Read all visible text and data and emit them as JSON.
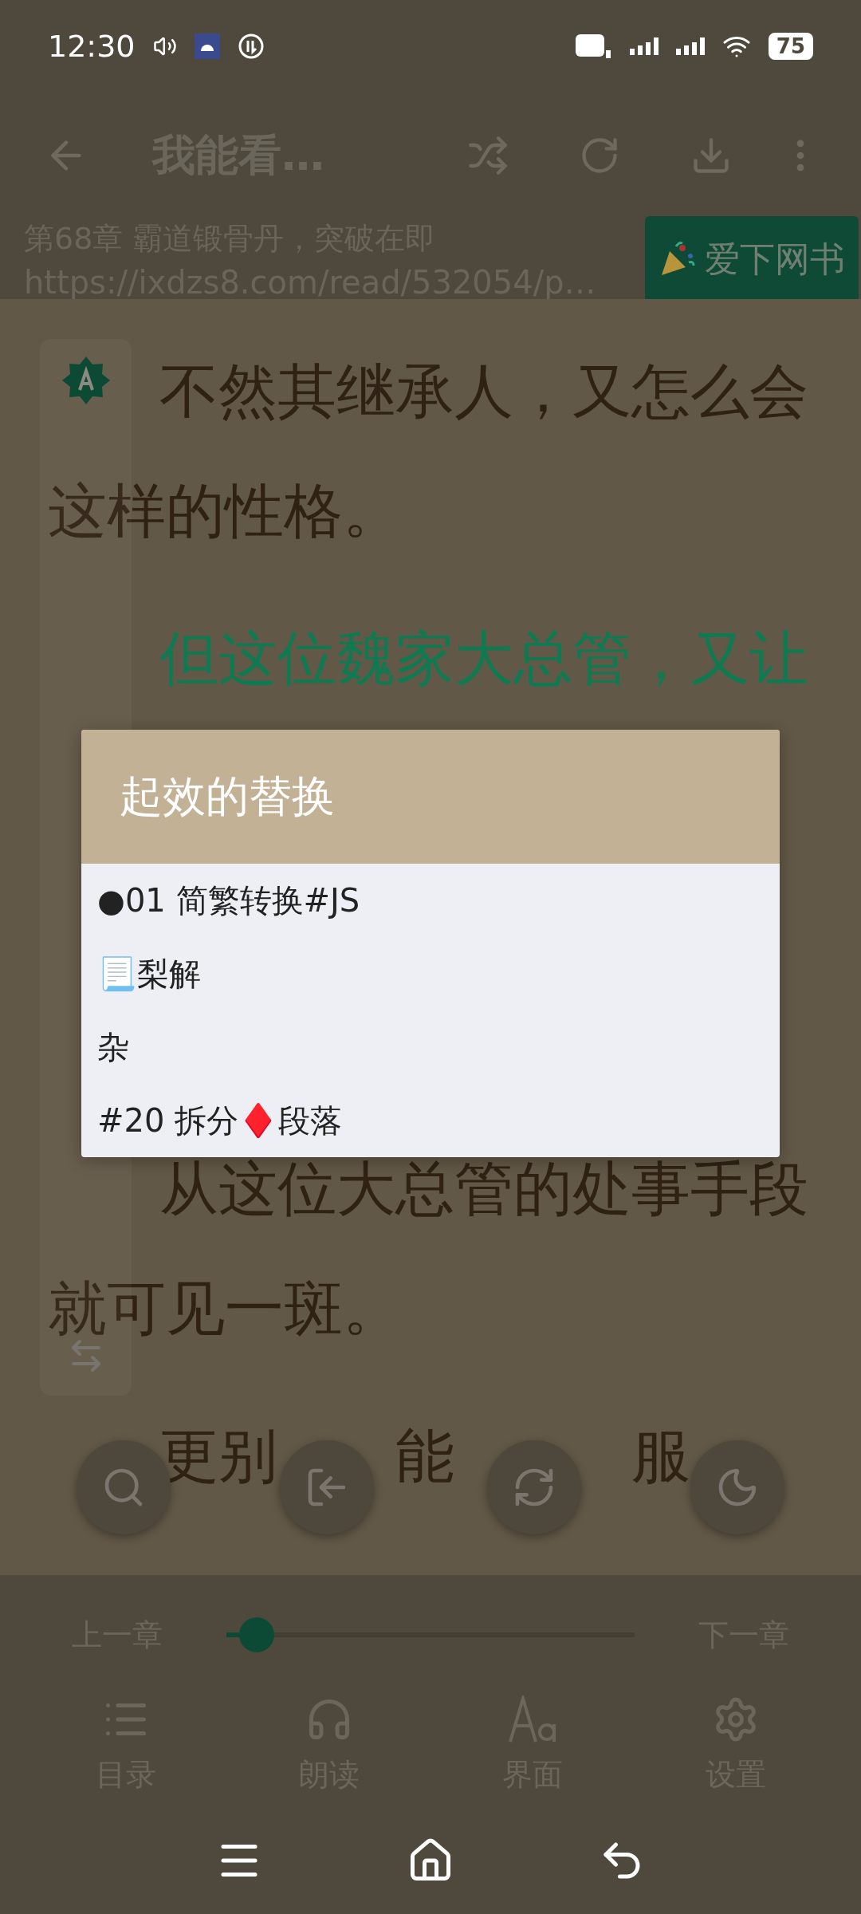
{
  "status_bar": {
    "time": "12:30",
    "battery": "75"
  },
  "toolbar": {
    "title": "我能看…"
  },
  "chapter": {
    "title": "第68章 霸道锻骨丹，突破在即",
    "url": "https://ixdzs8.com/read/532054/p…",
    "source_button": "爱下网书"
  },
  "text_above": [
    {
      "lines": [
        "不然其继承人，又怎么会",
        "这样的性格。"
      ],
      "highlighted": false
    },
    {
      "lines": [
        "但这位魏家大总管，又让"
      ],
      "highlighted": true
    }
  ],
  "text_below": [
    {
      "lines": [
        "从这位大总管的处事手段",
        "就可见一斑。"
      ],
      "highlighted": false
    },
    {
      "segments": [
        "更别",
        "能",
        "服"
      ],
      "highlighted": false
    }
  ],
  "dialog": {
    "title": "起效的替换",
    "items": [
      "●01 简繁转换#JS",
      "📃梨解",
      "杂",
      "#20 拆分♦️段落"
    ]
  },
  "chapter_nav": {
    "previous": "上一章",
    "next": "下一章",
    "level": 0.075
  },
  "menu": [
    {
      "kind": "toc",
      "label": "目录"
    },
    {
      "kind": "read_aloud",
      "label": "朗读"
    },
    {
      "kind": "interface",
      "label": "界面"
    },
    {
      "kind": "settings",
      "label": "设置"
    }
  ]
}
